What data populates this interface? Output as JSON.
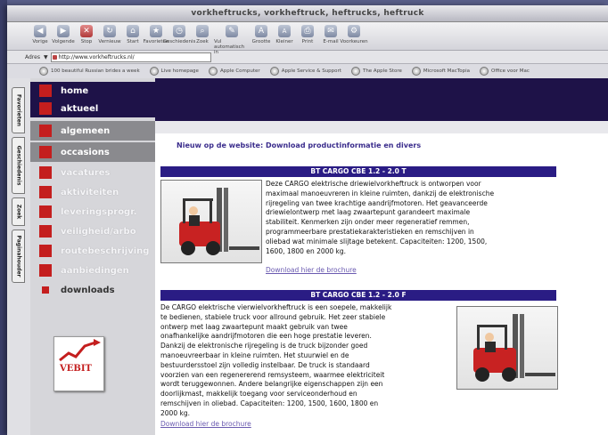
{
  "window": {
    "title": "vorkheftrucks, vorkheftruck, heftrucks, heftruck"
  },
  "toolbar": {
    "buttons": [
      "Vorige",
      "Volgende",
      "Stop",
      "Vernieuw",
      "Start",
      "Favorieten",
      "Geschiedenis",
      "Zoek",
      "Vul automatisch in",
      "Grootte",
      "Kleiner",
      "Print",
      "E-mail",
      "Voorkeuren"
    ]
  },
  "address": {
    "label": "Adres",
    "url": "http://www.vorkheftrucks.nl/"
  },
  "favorites": [
    "100 beautiful Russian brides a week",
    "Live homepage",
    "Apple Computer",
    "Apple Service & Support",
    "The Apple Store",
    "Microsoft MacTopia",
    "Office voor Mac"
  ],
  "side_tabs": [
    "Favorieten",
    "Geschiedenis",
    "Zoek",
    "Paginahouder"
  ],
  "nav": {
    "items": [
      "home",
      "aktueel",
      "algemeen",
      "occasions",
      "vacatures",
      "aktiviteiten",
      "leveringsprogr.",
      "veiligheid/arbo",
      "routebeschrijving",
      "aanbiedingen",
      "downloads"
    ]
  },
  "logo": {
    "text": "VEBIT"
  },
  "main": {
    "headline": "Nieuw op de website: Download productinformatie en divers",
    "products": [
      {
        "title": "BT CARGO CBE 1.2 - 2.0 T",
        "lines": [
          "Deze CARGO elektrische driewielvorkheftruck is ontworpen voor",
          "maximaal manoeuvreren in kleine ruimten, dankzij de elektronische",
          "rijregeling van twee krachtige aandrijfmotoren. Het geavanceerde",
          "driewielontwerp met laag zwaartepunt garandeert maximale",
          "stabiliteit. Kenmerken zijn onder meer regeneratief remmen,",
          "programmeerbare prestatiekarakteristieken en remschijven in",
          "oliebad wat minimale slijtage betekent. Capaciteiten: 1200, 1500,",
          "1600, 1800 en 2000 kg."
        ],
        "link": "Download hier de brochure"
      },
      {
        "title": "BT CARGO CBE 1.2 - 2.0 F",
        "lines": [
          "De CARGO elektrische vierwielvorkheftruck is een soepele, makkelijk",
          "te bedienen, stabiele truck voor allround gebruik. Het zeer stabiele",
          "ontwerp met laag zwaartepunt maakt gebruik van twee",
          "onafhankelijke aandrijfmotoren die een hoge prestatie leveren.",
          "Dankzij de elektronische rijregeling is de truck bijzonder goed",
          "manoeuvreerbaar in kleine ruimten. Het stuurwiel en de",
          "bestuurdersstoel zijn volledig instelbaar. De truck is standaard",
          "voorzien van een regenererend remsysteem, waarmee elektriciteit",
          "wordt teruggewonnen. Andere belangrijke eigenschappen zijn een",
          "doorlijkmast, makkelijk toegang voor serviceonderhoud en",
          "remschijven in oliebad. Capaciteiten: 1200, 1500, 1600, 1800 en",
          "2000 kg."
        ],
        "link": "Download hier de brochure"
      }
    ]
  }
}
